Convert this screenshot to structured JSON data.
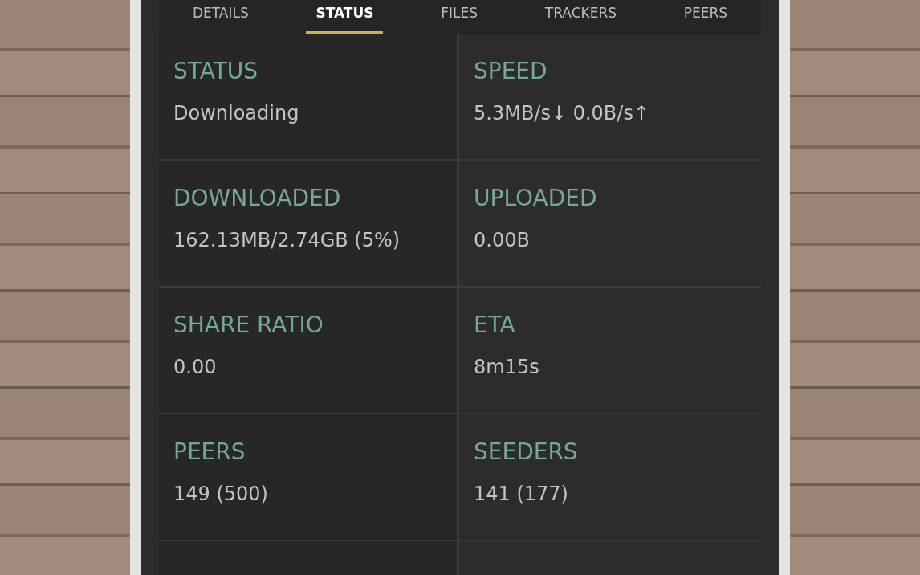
{
  "tabs": [
    {
      "label": "DETAILS",
      "selected": false
    },
    {
      "label": "STATUS",
      "selected": true
    },
    {
      "label": "FILES",
      "selected": false
    },
    {
      "label": "TRACKERS",
      "selected": false
    },
    {
      "label": "PEERS",
      "selected": false
    }
  ],
  "fields": [
    {
      "label": "STATUS",
      "value": "Downloading"
    },
    {
      "label": "SPEED",
      "value": "5.3MB/s↓ 0.0B/s↑"
    },
    {
      "label": "DOWNLOADED",
      "value": "162.13MB/2.74GB (5%)"
    },
    {
      "label": "UPLOADED",
      "value": "0.00B"
    },
    {
      "label": "SHARE RATIO",
      "value": "0.00"
    },
    {
      "label": "ETA",
      "value": "8m15s"
    },
    {
      "label": "PEERS",
      "value": "149 (500)"
    },
    {
      "label": "SEEDERS",
      "value": "141 (177)"
    }
  ]
}
